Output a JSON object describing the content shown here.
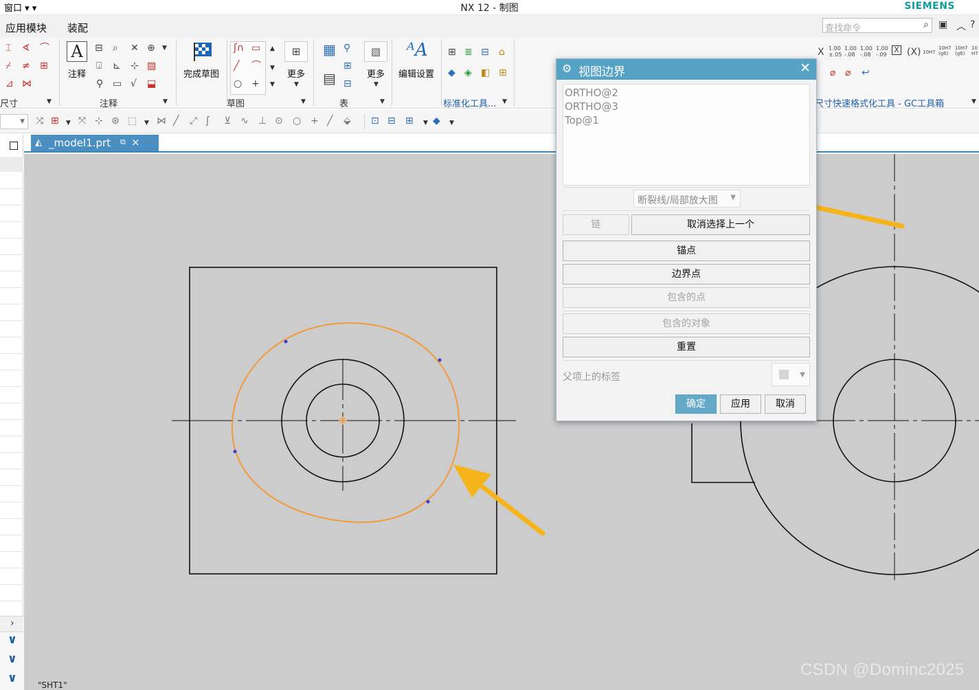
{
  "titlebar": {
    "window_menu": "窗口 ▾ ▾",
    "title": "NX 12 - 制图",
    "brand": "SIEMENS"
  },
  "menubar": {
    "items": [
      "应用模块",
      "装配"
    ],
    "search_placeholder": "查找命令"
  },
  "ribbon": {
    "groups": {
      "dimension": "尺寸",
      "annotation": "注释",
      "sketch": "草图",
      "table": "表",
      "standardize": "标准化工具...",
      "gc": "尺寸快速格式化工具 - GC工具箱"
    },
    "buttons": {
      "note": "注释",
      "finish_sketch": "完成草图",
      "more1": "更多",
      "more2": "更多",
      "edit_settings": "编辑设置"
    },
    "tol_text": "1.00"
  },
  "tabs": {
    "model": "_model1.prt"
  },
  "canvas": {
    "sheet_label": "\"SHT1\"",
    "watermark": "CSDN @Dominc2025"
  },
  "dialog": {
    "title": "视图边界",
    "views": [
      "ORTHO@2",
      "ORTHO@3",
      "Top@1"
    ],
    "boundary_type": "断裂线/局部放大图",
    "chain_label": "链",
    "deselect_label": "取消选择上一个",
    "anchor_label": "锚点",
    "boundary_point_label": "边界点",
    "contained_points_label": "包含的点",
    "contained_objects_label": "包含的对象",
    "reset_label": "重置",
    "parent_label_text": "父项上的标签",
    "ok_label": "确定",
    "apply_label": "应用",
    "cancel_label": "取消"
  },
  "colors": {
    "accent": "#56a2c4",
    "boundary_curve": "#f39a3a",
    "arrow": "#f5b41a",
    "canvas_bg": "#cccccc",
    "tab_active": "#4a8ec2"
  },
  "icons": [
    "gear-icon",
    "close-icon",
    "search-icon",
    "dropdown-arrow-icon",
    "checker-flag-icon",
    "chevron-down-icon",
    "chevron-right-icon"
  ]
}
